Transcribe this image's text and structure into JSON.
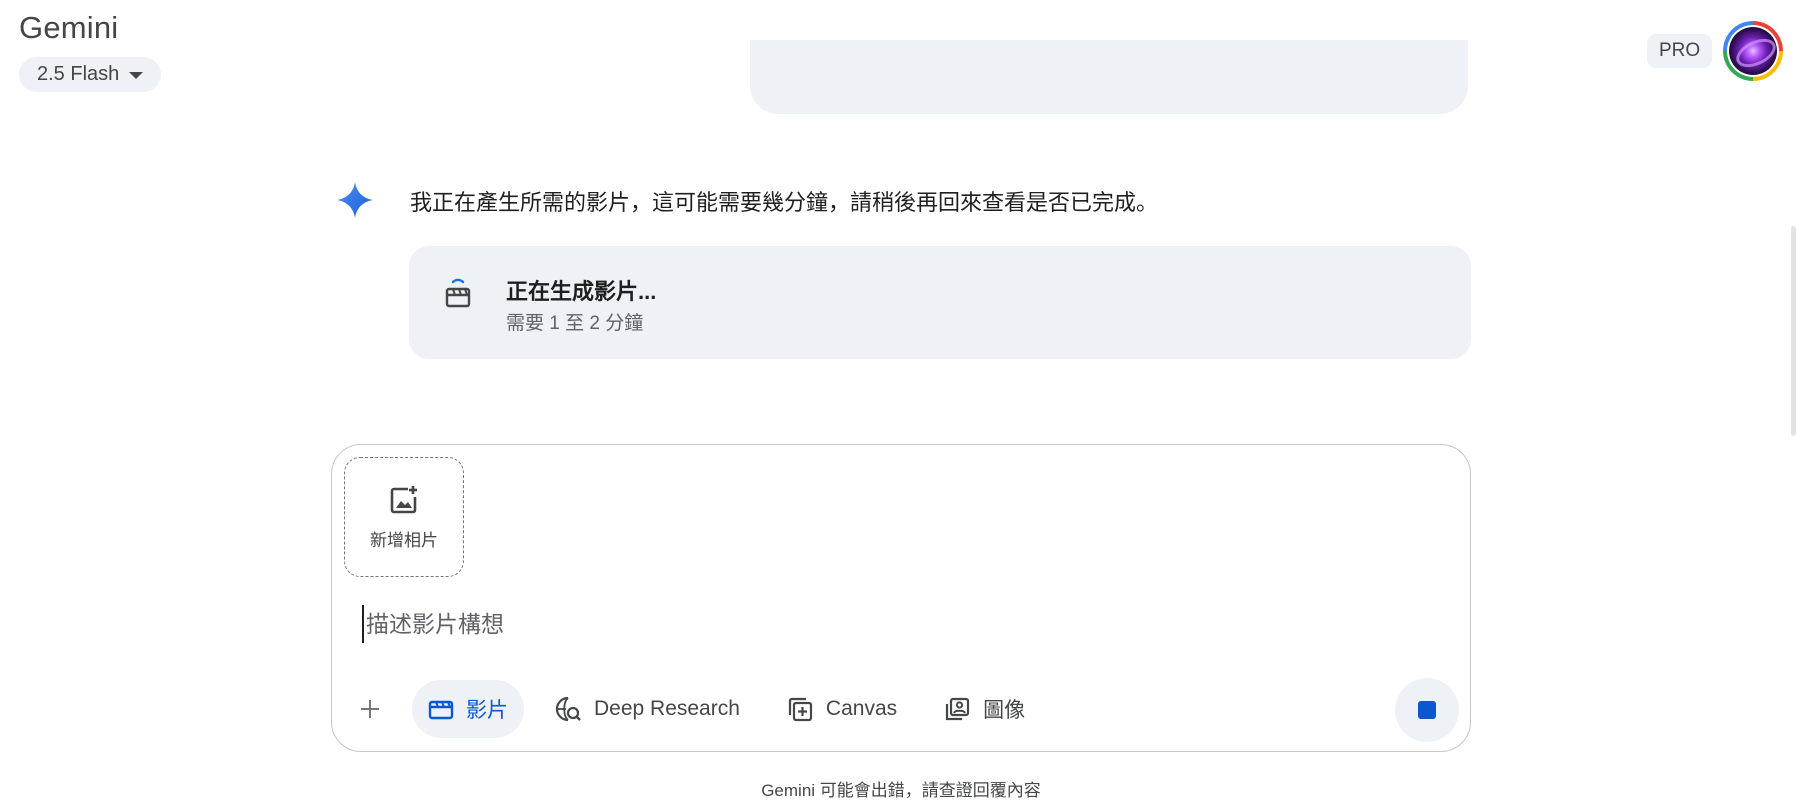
{
  "header": {
    "app_title": "Gemini",
    "model_label": "2.5 Flash",
    "plan_badge": "PRO"
  },
  "conversation": {
    "response_text": "我正在產生所需的影片，這可能需要幾分鐘，請稍後再回來查看是否已完成。",
    "video_card": {
      "title": "正在生成影片...",
      "subtitle": "需要 1 至 2 分鐘"
    }
  },
  "composer": {
    "add_photo_label": "新增相片",
    "input_placeholder": "描述影片構想",
    "input_value": "",
    "tools": [
      {
        "label": "影片",
        "icon": "clapperboard-icon",
        "active": true
      },
      {
        "label": "Deep Research",
        "icon": "globe-search-icon",
        "active": false
      },
      {
        "label": "Canvas",
        "icon": "canvas-add-icon",
        "active": false
      },
      {
        "label": "圖像",
        "icon": "image-library-icon",
        "active": false
      }
    ]
  },
  "footer": {
    "disclaimer": "Gemini 可能會出錯，請查證回覆內容"
  },
  "colors": {
    "accent": "#0b57d0",
    "surface": "#eef1f6",
    "gemini_star": "#4285f4"
  }
}
